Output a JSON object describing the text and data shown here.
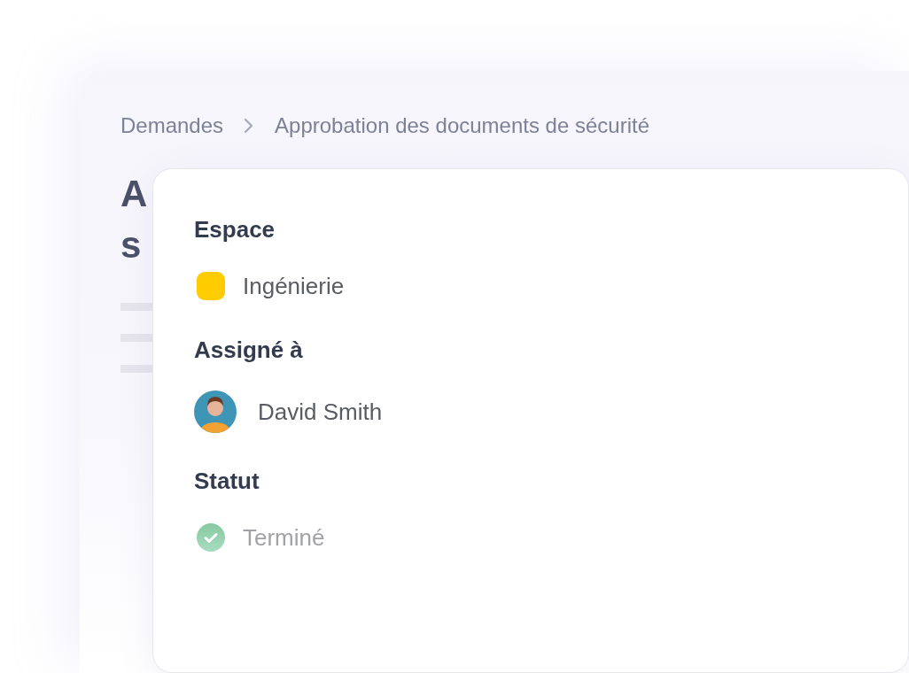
{
  "breadcrumb": [
    {
      "label": "Demandes"
    },
    {
      "label": "Approbation des documents de sécurité"
    }
  ],
  "title_lines": [
    "A",
    "s"
  ],
  "details": {
    "space_label": "Espace",
    "space": {
      "name": "Ingénierie",
      "color": "#ffcc00"
    },
    "assignee_label": "Assigné à",
    "assignee": {
      "name": "David Smith"
    },
    "status_label": "Statut",
    "status": {
      "label": "Terminé",
      "done": true
    }
  }
}
